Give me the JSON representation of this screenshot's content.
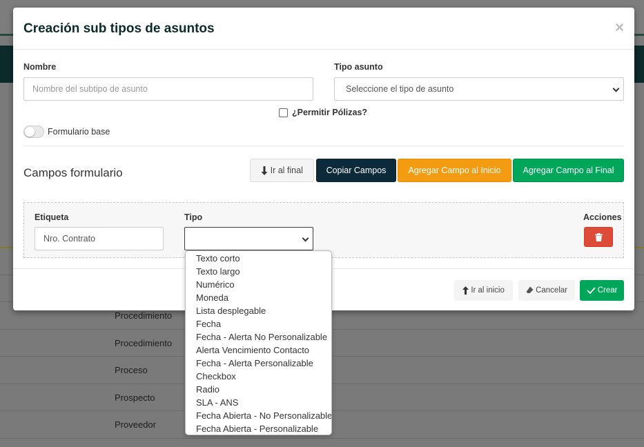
{
  "background": {
    "rows": [
      "Procedimiento",
      "Procedimiento",
      "Proceso",
      "Prospecto",
      "Proveedor"
    ]
  },
  "modal": {
    "title": "Creación sub tipos de asuntos",
    "close": "×",
    "nombre_label": "Nombre",
    "nombre_placeholder": "Nombre del subtipo de asunto",
    "tipo_asunto_label": "Tipo asunto",
    "tipo_asunto_value": "Seleccione el tipo de asunto",
    "permitir_polizas_label": "¿Permitir Pólizas?",
    "formulario_base_label": "Formulario base",
    "section_title": "Campos formulario",
    "buttons": {
      "ir_al_final": "Ir al final",
      "copiar_campos": "Copiar Campos",
      "agregar_inicio": "Agregar Campo al Inicio",
      "agregar_final": "Agregar Campo al Final"
    },
    "fields_table": {
      "etiqueta_header": "Etiqueta",
      "tipo_header": "Tipo",
      "acciones_header": "Acciones",
      "row": {
        "etiqueta_value": "Nro. Contrato",
        "tipo_value": ""
      }
    },
    "footer": {
      "ir_al_inicio": "Ir al inicio",
      "cancelar": "Cancelar",
      "crear": "Crear"
    }
  },
  "dropdown_options": [
    "Texto corto",
    "Texto largo",
    "Numérico",
    "Moneda",
    "Lista desplegable",
    "Fecha",
    "Fecha - Alerta No Personalizable",
    "Alerta Vencimiento Contacto",
    "Fecha - Alerta Personalizable",
    "Checkbox",
    "Radio",
    "SLA - ANS",
    "Fecha Abierta - No Personalizable",
    "Fecha Abierta - Personalizable"
  ],
  "colors": {
    "navbar": "#0d2a2b",
    "btn_dark": "#0d2a3a",
    "btn_warning": "#f39c12",
    "btn_success": "#00a65a",
    "btn_danger": "#dd4b39"
  }
}
